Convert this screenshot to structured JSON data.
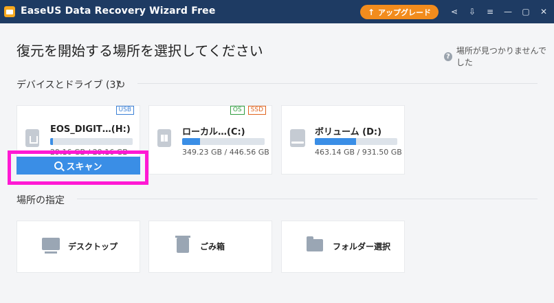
{
  "window": {
    "title": "EaseUS Data Recovery Wizard Free",
    "upgrade_label": "アップグレード",
    "icons": [
      "share-icon",
      "export-icon",
      "menu-icon",
      "minimize-icon",
      "maximize-icon",
      "close-icon"
    ]
  },
  "header": {
    "title": "復元を開始する場所を選択してください",
    "help_text": "場所が見つかりませんでした"
  },
  "devices": {
    "section_title": "デバイスとドライブ (3)",
    "drives": [
      {
        "name": "EOS_DIGIT…(H:)",
        "capacity": "29.16 GB / 29.16 GB",
        "usage": 0.03,
        "badges": [
          "USB"
        ],
        "icon": "usb-drive-icon"
      },
      {
        "name": "ローカル…(C:)",
        "capacity": "349.23 GB / 446.56 GB",
        "usage": 0.22,
        "badges": [
          "OS",
          "SSD"
        ],
        "icon": "os-drive-icon"
      },
      {
        "name": "ボリューム (D:)",
        "capacity": "463.14 GB / 931.50 GB",
        "usage": 0.5,
        "badges": [],
        "icon": "hard-drive-icon"
      }
    ],
    "scan_label": "スキャン"
  },
  "locations": {
    "section_title": "場所の指定",
    "items": [
      {
        "label": "デスクトップ",
        "icon": "desktop-icon"
      },
      {
        "label": "ごみ箱",
        "icon": "trash-icon"
      },
      {
        "label": "フォルダー選択",
        "icon": "folder-icon"
      }
    ]
  },
  "colors": {
    "titlebar": "#1e3b63",
    "accent": "#3a8ee6",
    "upgrade": "#f28c1d",
    "highlight": "#ff19d4"
  }
}
